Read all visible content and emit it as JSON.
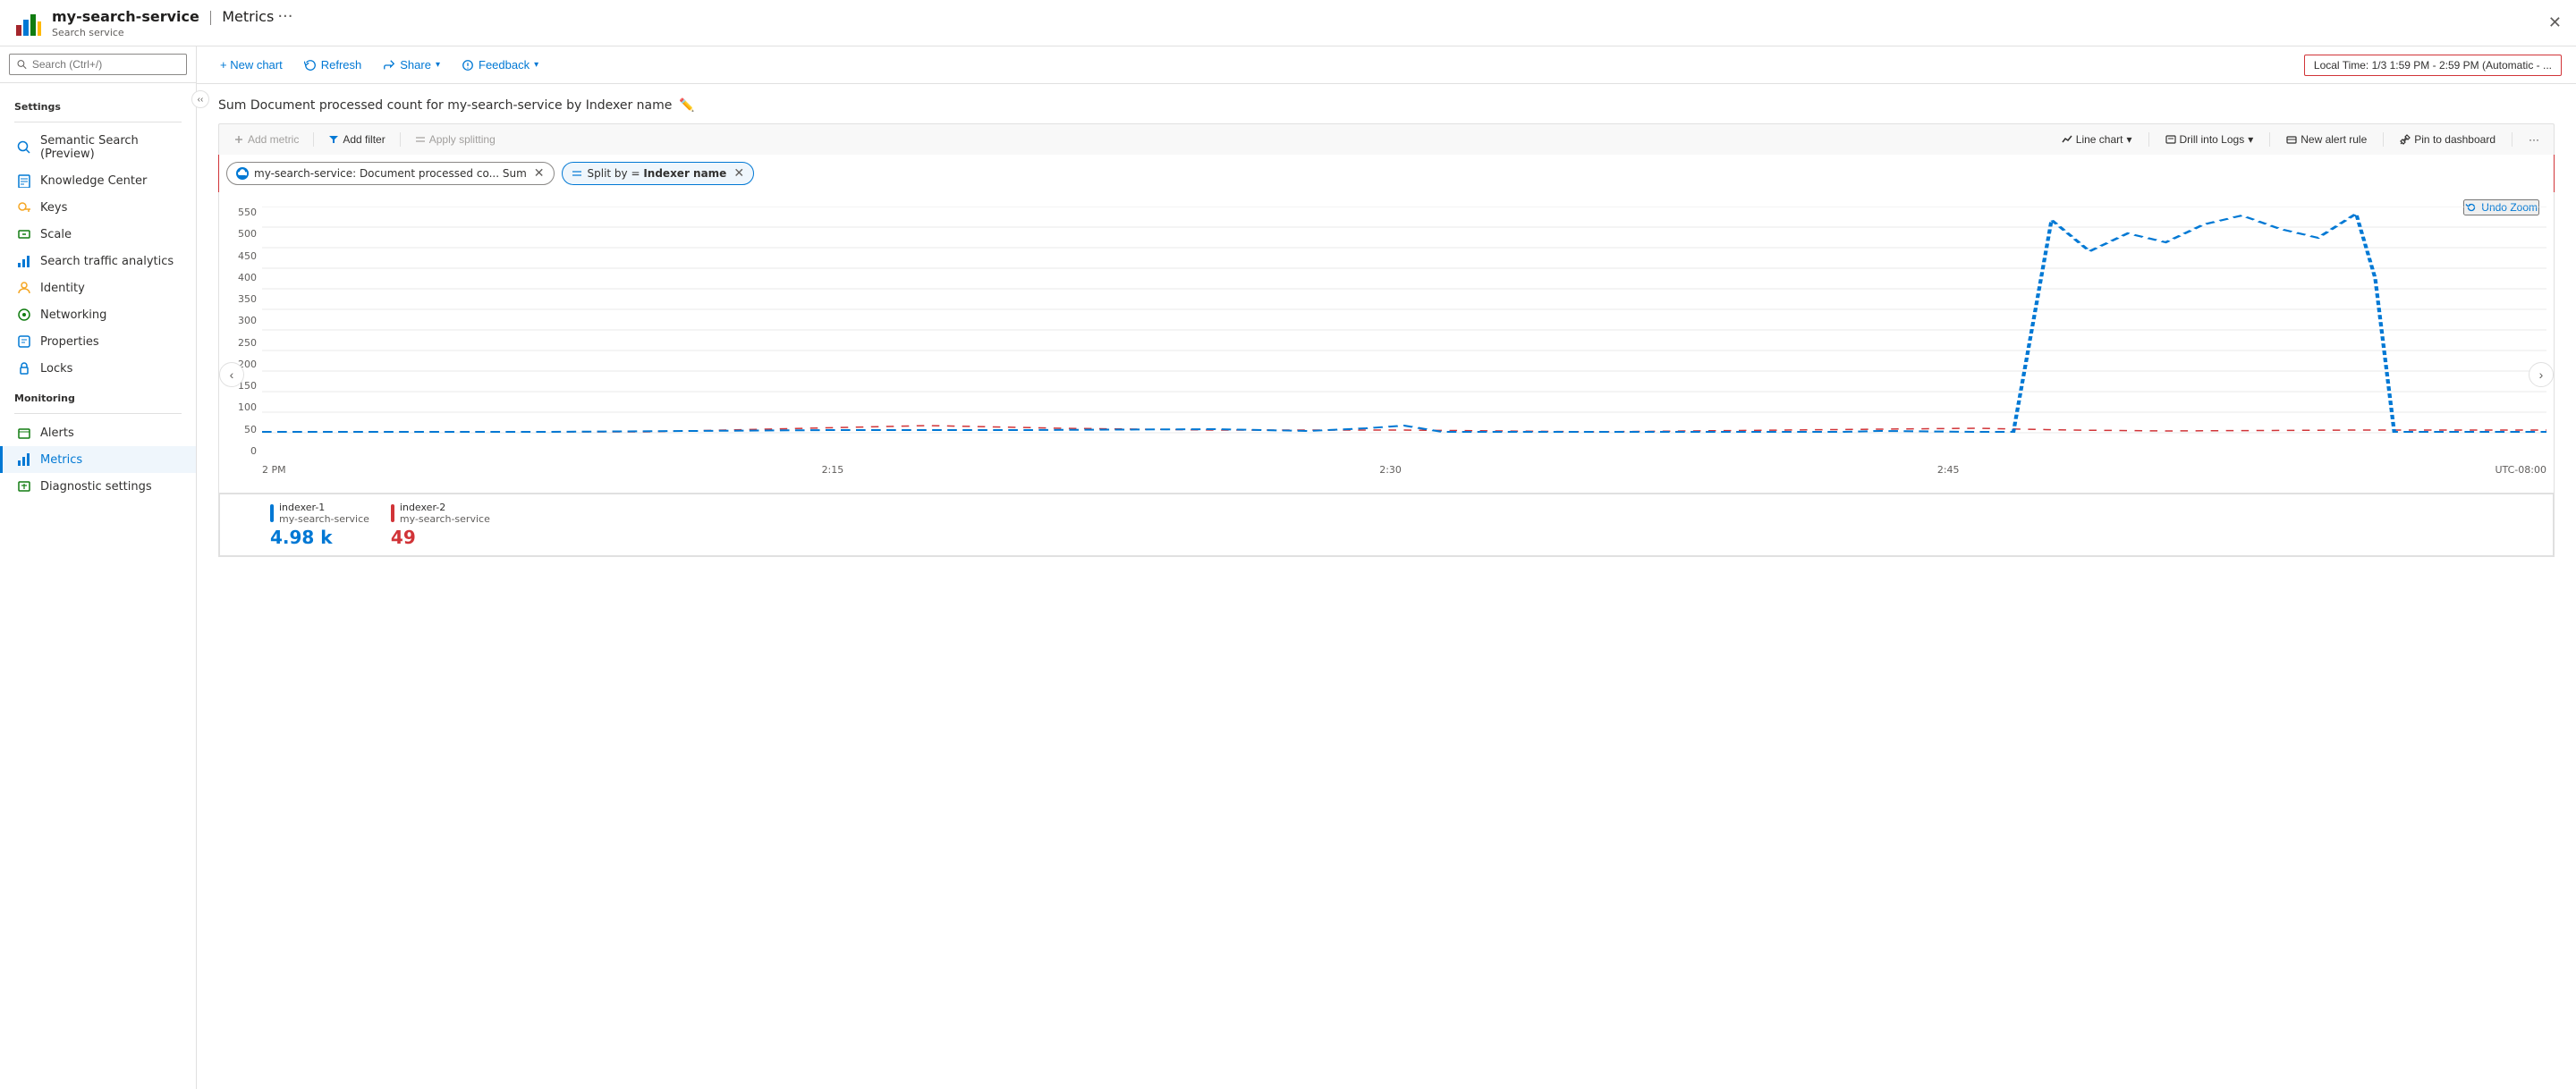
{
  "app": {
    "title": "my-search-service",
    "separator": "|",
    "page": "Metrics",
    "subtitle": "Search service",
    "dots": "···",
    "close": "✕"
  },
  "search": {
    "placeholder": "Search (Ctrl+/)"
  },
  "sidebar": {
    "settings_title": "Settings",
    "items_settings": [
      {
        "id": "semantic-search",
        "label": "Semantic Search (Preview)",
        "icon": "search"
      },
      {
        "id": "knowledge-center",
        "label": "Knowledge Center",
        "icon": "book"
      },
      {
        "id": "keys",
        "label": "Keys",
        "icon": "key"
      },
      {
        "id": "scale",
        "label": "Scale",
        "icon": "scale"
      },
      {
        "id": "search-traffic",
        "label": "Search traffic analytics",
        "icon": "analytics"
      },
      {
        "id": "identity",
        "label": "Identity",
        "icon": "identity"
      },
      {
        "id": "networking",
        "label": "Networking",
        "icon": "network"
      },
      {
        "id": "properties",
        "label": "Properties",
        "icon": "properties"
      },
      {
        "id": "locks",
        "label": "Locks",
        "icon": "lock"
      }
    ],
    "monitoring_title": "Monitoring",
    "items_monitoring": [
      {
        "id": "alerts",
        "label": "Alerts",
        "icon": "alert"
      },
      {
        "id": "metrics",
        "label": "Metrics",
        "icon": "metrics",
        "active": true
      },
      {
        "id": "diagnostic",
        "label": "Diagnostic settings",
        "icon": "diagnostic"
      }
    ]
  },
  "toolbar": {
    "new_chart": "+ New chart",
    "refresh": "Refresh",
    "share": "Share",
    "feedback": "Feedback",
    "time_range": "Local Time: 1/3 1:59 PM - 2:59 PM (Automatic - ..."
  },
  "metric_toolbar": {
    "add_metric": "Add metric",
    "add_filter": "Add filter",
    "apply_splitting": "Apply splitting",
    "line_chart": "Line chart",
    "drill_logs": "Drill into Logs",
    "new_alert": "New alert rule",
    "pin_dashboard": "Pin to dashboard",
    "more": "···"
  },
  "chart": {
    "title": "Sum Document processed count for my-search-service by Indexer name",
    "metric_pill": "my-search-service: Document processed co...  Sum",
    "split_pill": "Split by = Indexer name",
    "undo_zoom": "Undo Zoom",
    "y_axis_values": [
      "550",
      "500",
      "450",
      "400",
      "350",
      "300",
      "250",
      "200",
      "150",
      "100",
      "50",
      "0"
    ],
    "x_axis_labels": [
      "2 PM",
      "2:15",
      "2:30",
      "2:45",
      "UTC-08:00"
    ],
    "legend": [
      {
        "id": "indexer-1",
        "name": "indexer-1",
        "service": "my-search-service",
        "value": "4.98 k",
        "color": "#0078d4"
      },
      {
        "id": "indexer-2",
        "name": "indexer-2",
        "service": "my-search-service",
        "value": "49",
        "color": "#d13438"
      }
    ]
  }
}
